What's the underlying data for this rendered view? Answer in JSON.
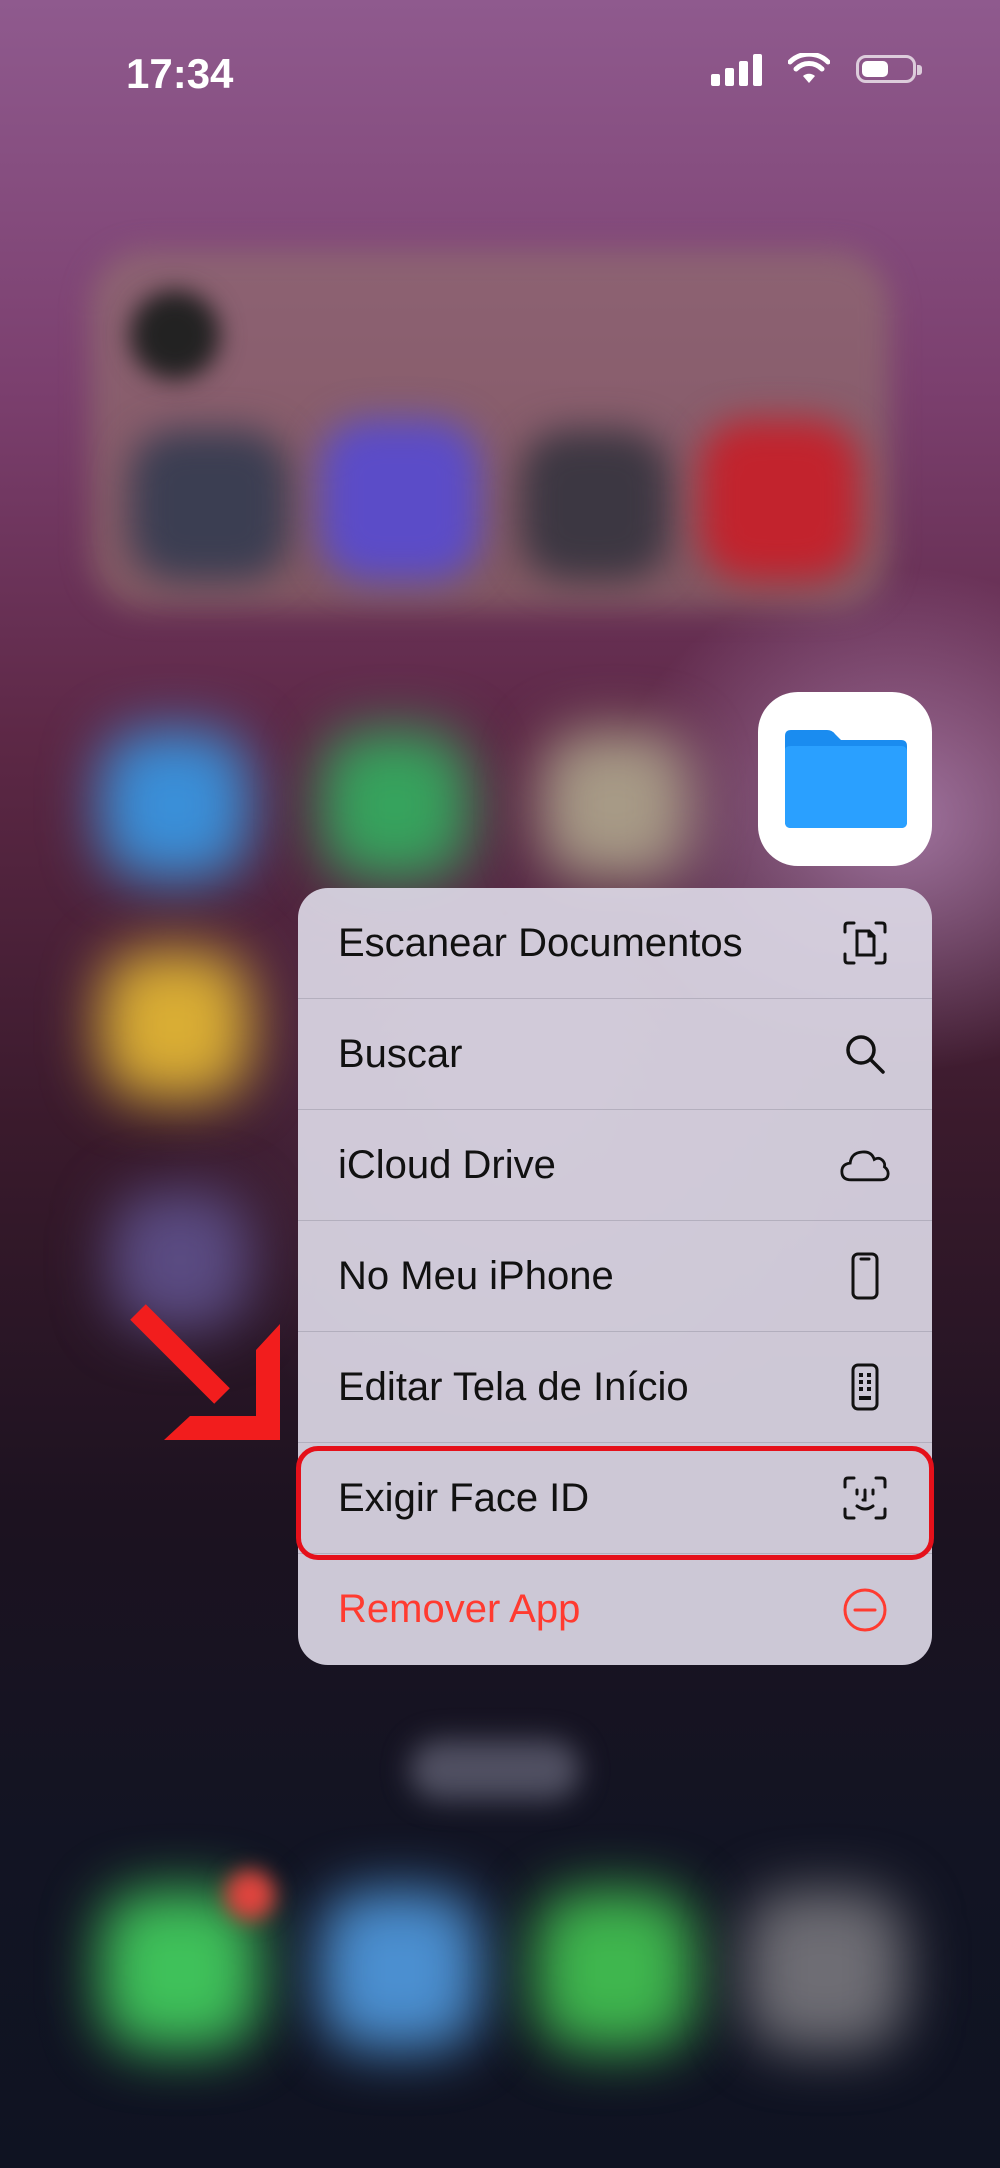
{
  "status_bar": {
    "time": "17:34"
  },
  "app": {
    "name_icon": "files-folder-icon"
  },
  "menu": {
    "items": [
      {
        "label": "Escanear Documentos",
        "icon": "scan-document-icon"
      },
      {
        "label": "Buscar",
        "icon": "search-icon"
      },
      {
        "label": "iCloud Drive",
        "icon": "cloud-icon"
      },
      {
        "label": "No Meu iPhone",
        "icon": "iphone-icon"
      },
      {
        "label": "Editar Tela de Início",
        "icon": "edit-home-screen-icon"
      },
      {
        "label": "Exigir Face ID",
        "icon": "face-id-icon"
      },
      {
        "label": "Remover App",
        "icon": "remove-minus-circle-icon"
      }
    ]
  },
  "colors": {
    "destructive": "#ff3b30",
    "annotation": "#e5101a",
    "folder": "#1e90ff"
  }
}
